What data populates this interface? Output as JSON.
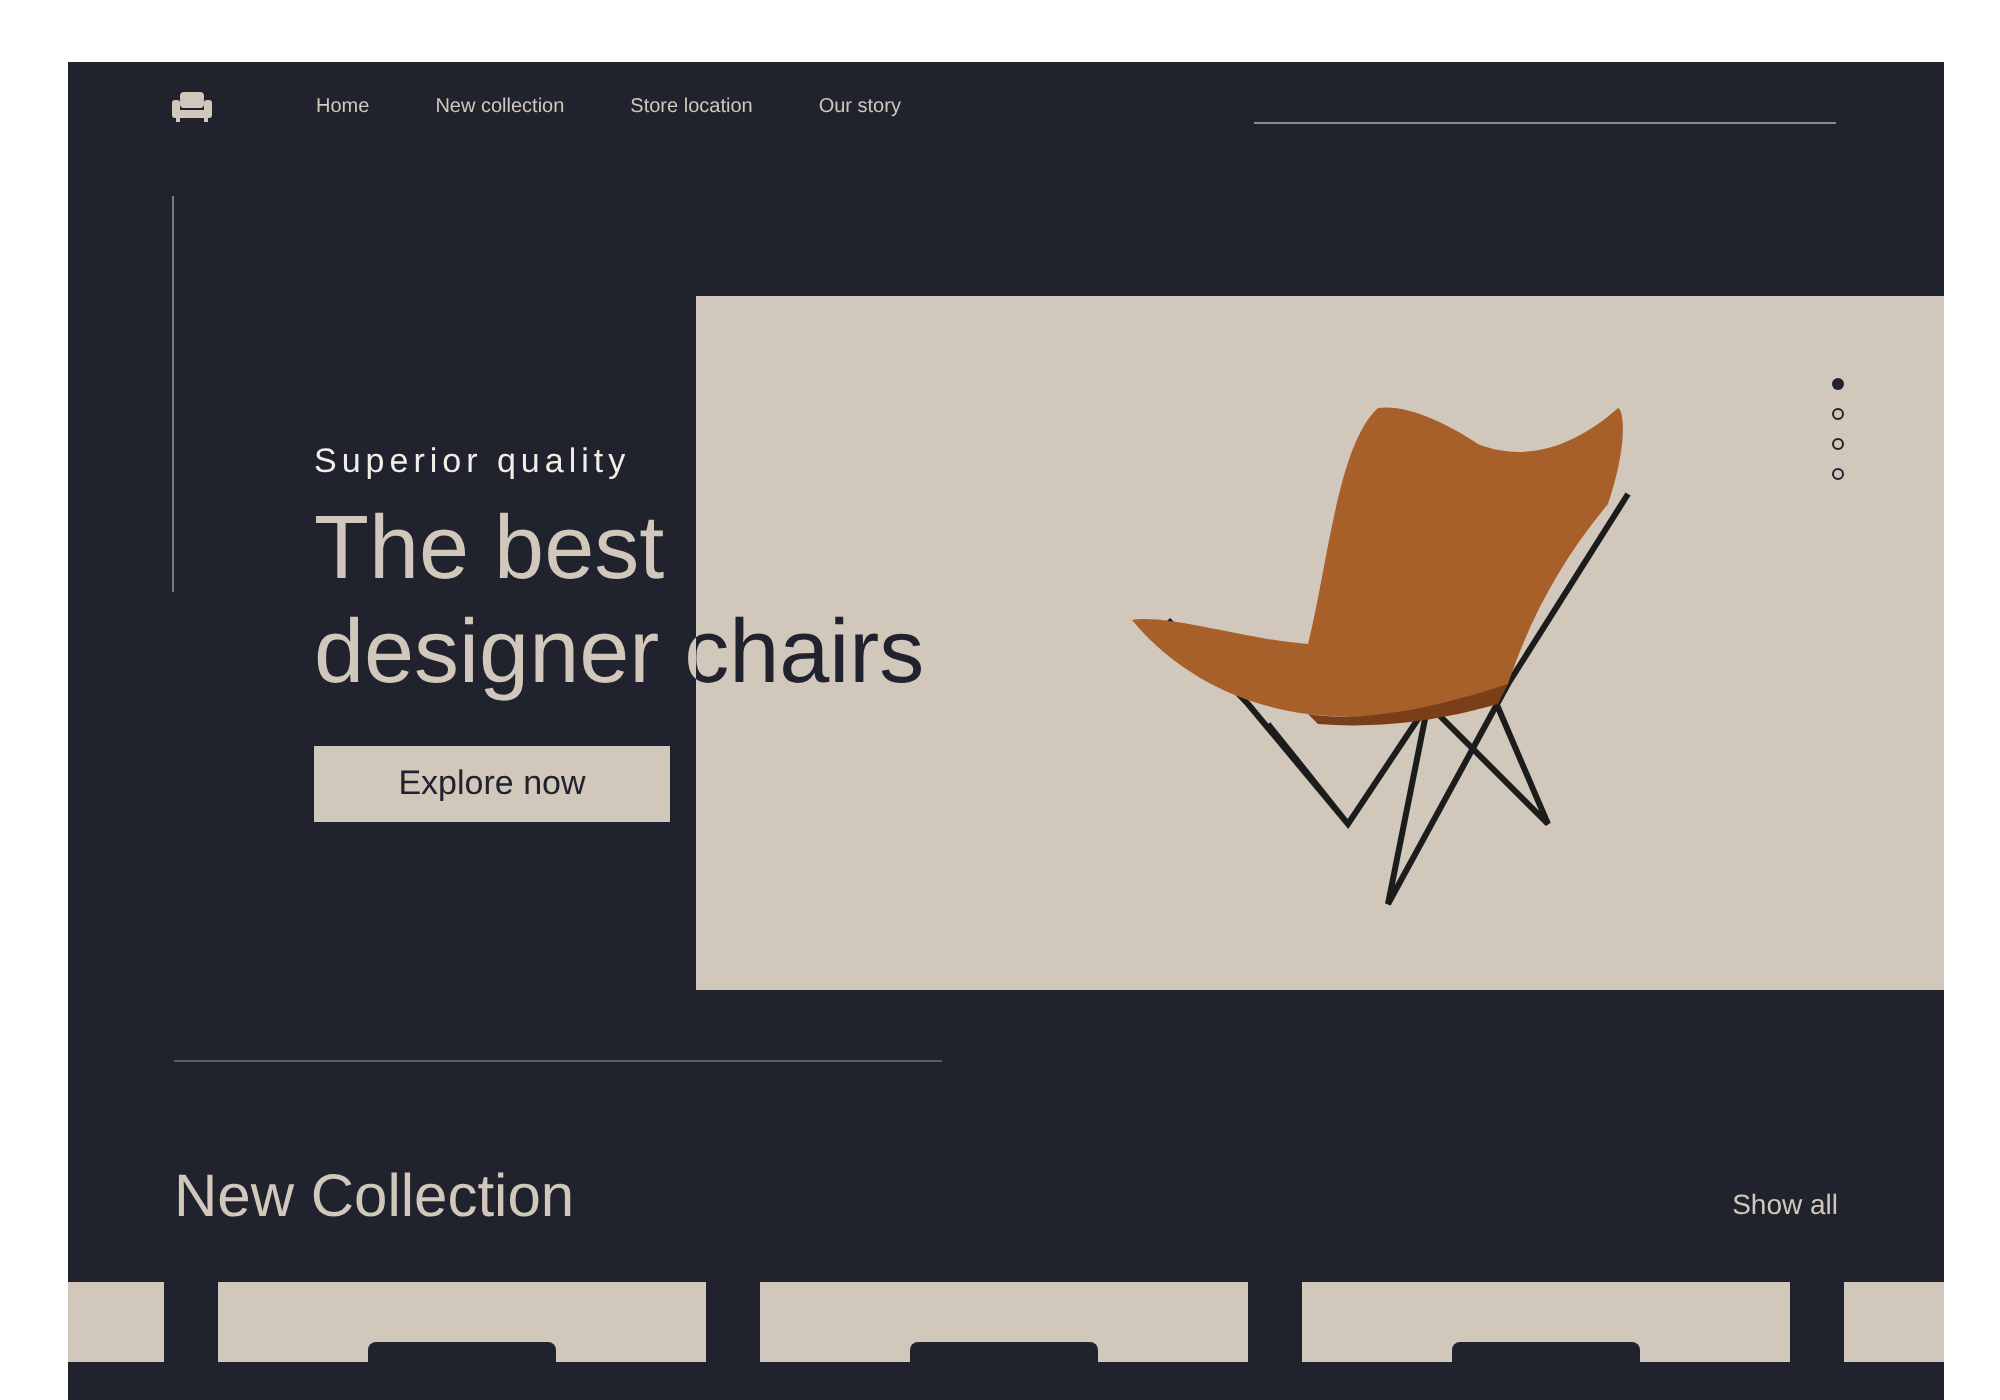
{
  "nav": {
    "links": [
      {
        "label": "Home"
      },
      {
        "label": "New collection"
      },
      {
        "label": "Store location"
      },
      {
        "label": "Our story"
      }
    ]
  },
  "hero": {
    "eyebrow": "Superior quality",
    "heading": "The best designer chairs",
    "button": "Explore now",
    "slides": [
      {
        "selected": true
      },
      {
        "selected": false
      },
      {
        "selected": false
      },
      {
        "selected": false
      }
    ]
  },
  "collection": {
    "heading": "New Collection",
    "show_all": "Show all"
  }
}
